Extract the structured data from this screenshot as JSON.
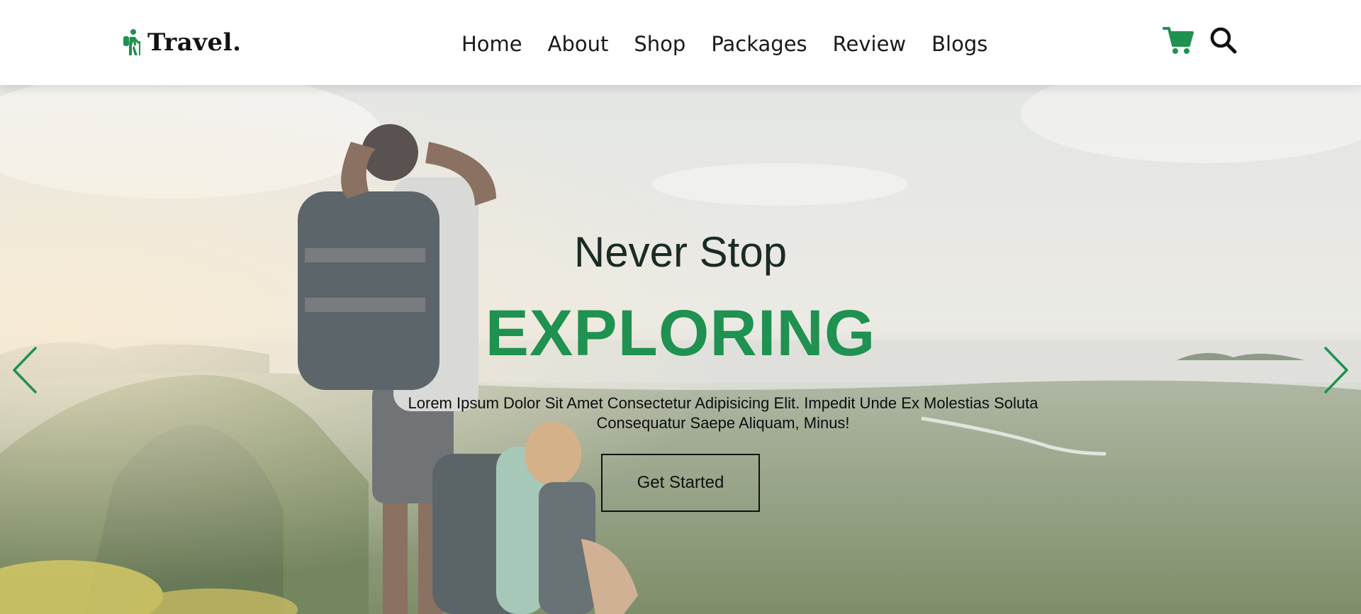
{
  "brand": {
    "name": "Travel.",
    "logo_icon": "hiker-icon",
    "accent_color": "#1f9150"
  },
  "nav": {
    "items": [
      {
        "label": "Home"
      },
      {
        "label": "About"
      },
      {
        "label": "Shop"
      },
      {
        "label": "Packages"
      },
      {
        "label": "Review"
      },
      {
        "label": "Blogs"
      }
    ]
  },
  "header_icons": {
    "cart": "cart-icon",
    "search": "search-icon",
    "cart_color": "#1f9150"
  },
  "hero": {
    "subtitle": "Never Stop",
    "title": "EXPLORING",
    "description": "Lorem Ipsum Dolor Sit Amet Consectetur Adipisicing Elit. Impedit Unde Ex Molestias Soluta Consequatur Saepe Aliquam, Minus!",
    "cta_label": "Get Started",
    "prev_icon": "chevron-left-icon",
    "next_icon": "chevron-right-icon"
  }
}
